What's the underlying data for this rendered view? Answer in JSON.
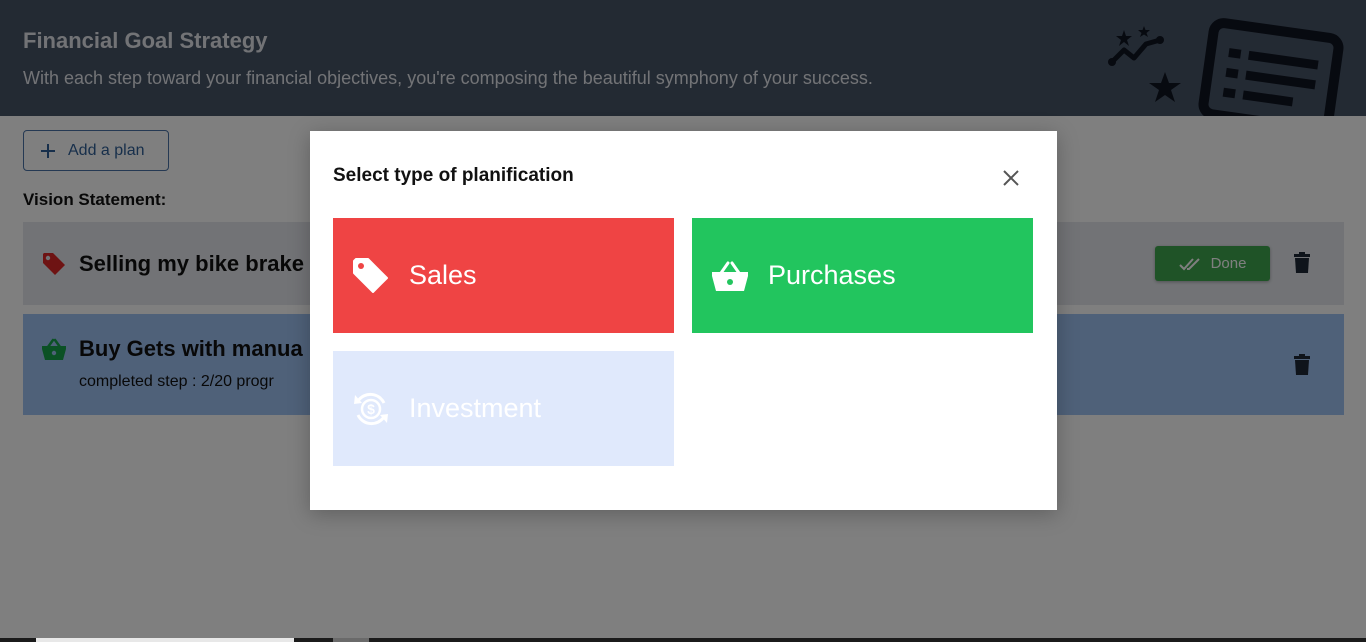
{
  "header": {
    "title": "Financial Goal Strategy",
    "subtitle": "With each step toward your financial objectives, you're composing the beautiful symphony of your success."
  },
  "toolbar": {
    "add_plan_label": "Add a plan"
  },
  "vision_label": "Vision Statement:",
  "plans": [
    {
      "type": "sales",
      "icon": "tag-icon",
      "title": "Selling my bike brake",
      "status_button": "Done",
      "color": "#dc2626"
    },
    {
      "type": "purchase",
      "icon": "basket-icon",
      "title": "Buy Gets with manua",
      "progress_text": "completed step : 2/20  progr",
      "color": "#16a34a"
    }
  ],
  "modal": {
    "title": "Select type of planification",
    "options": [
      {
        "label": "Sales",
        "icon": "tag-icon",
        "color": "#ef4444"
      },
      {
        "label": "Purchases",
        "icon": "basket-icon",
        "color": "#22c55e"
      },
      {
        "label": "Investment",
        "icon": "dollar-cycle-icon",
        "color": "#e0e9fc"
      }
    ]
  }
}
